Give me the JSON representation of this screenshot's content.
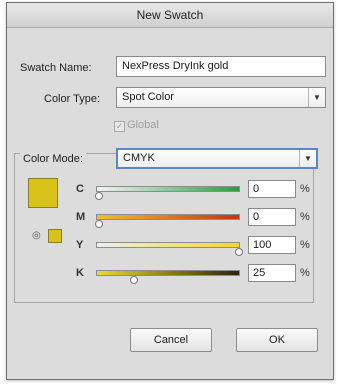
{
  "dialog": {
    "title": "New Swatch",
    "swatch_name_label": "Swatch Name:",
    "swatch_name_value": "NexPress DryInk gold",
    "color_type_label": "Color Type:",
    "color_type_value": "Spot Color",
    "global_label": "Global",
    "global_checked": true,
    "color_mode_label": "Color Mode:",
    "color_mode_value": "CMYK",
    "swatch_color": "#d9c219",
    "channels": [
      {
        "label": "C",
        "value": "0",
        "unit": "%",
        "fraction": 0.0
      },
      {
        "label": "M",
        "value": "0",
        "unit": "%",
        "fraction": 0.0
      },
      {
        "label": "Y",
        "value": "100",
        "unit": "%",
        "fraction": 1.0
      },
      {
        "label": "K",
        "value": "25",
        "unit": "%",
        "fraction": 0.25
      }
    ],
    "cancel_label": "Cancel",
    "ok_label": "OK"
  }
}
